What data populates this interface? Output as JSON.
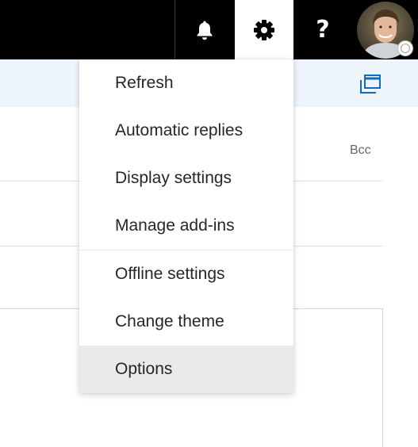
{
  "topbar": {
    "icons": {
      "notifications": "bell-icon",
      "settings": "gear-icon",
      "help": "help-icon"
    },
    "help_glyph": "?",
    "active_color": "#ffffff",
    "bar_color": "#000000"
  },
  "compose": {
    "bcc_label": "Bcc",
    "popout_icon": "popout-icon",
    "band_color": "#eef4fc"
  },
  "settings_menu": {
    "items": [
      {
        "label": "Refresh"
      },
      {
        "label": "Automatic replies"
      },
      {
        "label": "Display settings"
      },
      {
        "label": "Manage add-ins"
      },
      {
        "label": "Offline settings"
      },
      {
        "label": "Change theme"
      },
      {
        "label": "Options",
        "selected": true
      }
    ],
    "highlight_color": "#eaeaea"
  }
}
